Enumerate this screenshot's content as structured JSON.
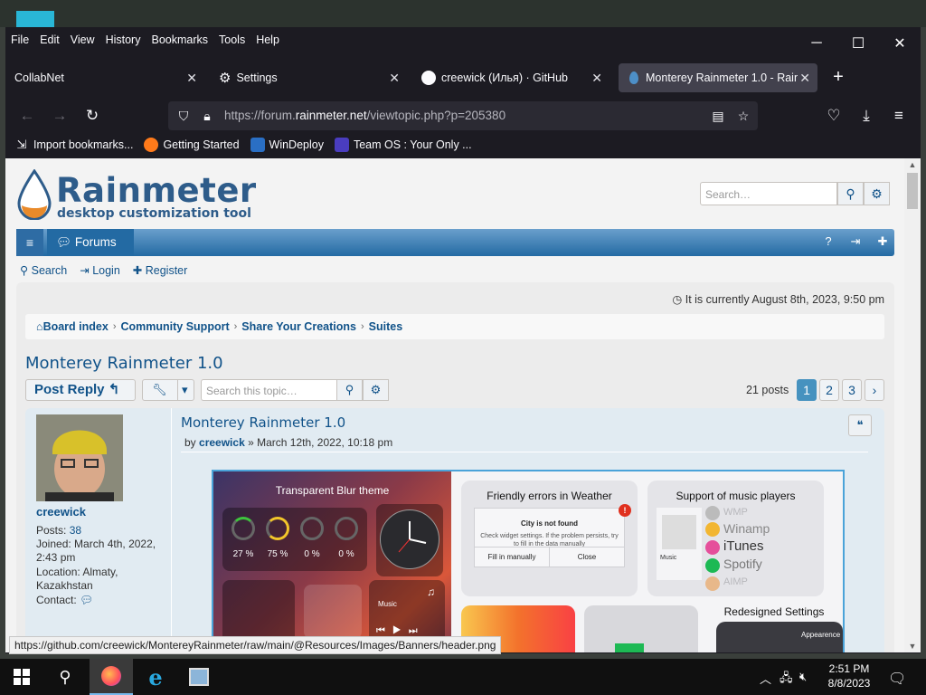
{
  "browser": {
    "menu": [
      "File",
      "Edit",
      "View",
      "History",
      "Bookmarks",
      "Tools",
      "Help"
    ],
    "window_controls": {
      "minimize": "─",
      "maximize": "☐",
      "close": "✕"
    },
    "tabs": [
      {
        "label": "CollabNet",
        "icon": "none"
      },
      {
        "label": "Settings",
        "icon": "gear-icon"
      },
      {
        "label": "creewick (Илья) · GitHub",
        "icon": "github-icon"
      },
      {
        "label": "Monterey Rainmeter 1.0 - Rainm",
        "icon": "rainmeter-drop-icon",
        "active": true
      }
    ],
    "url_prefix": "https://forum.",
    "url_domain": "rainmeter.net",
    "url_path": "/viewtopic.php?p=205380",
    "bookmarks": [
      {
        "label": "Import bookmarks...",
        "icon": "import-icon"
      },
      {
        "label": "Getting Started",
        "icon": "firefox-icon"
      },
      {
        "label": "WinDeploy",
        "icon": "windeploy-icon"
      },
      {
        "label": "Team OS : Your Only ...",
        "icon": "teamos-icon"
      }
    ],
    "status_url": "https://github.com/creewick/MontereyRainmeter/raw/main/@Resources/Images/Banners/header.png"
  },
  "site": {
    "logo_title": "Rainmeter",
    "logo_tagline": "desktop customization tool",
    "search_placeholder": "Search…",
    "nav_forums": "Forums",
    "subnav": {
      "search": "Search",
      "login": "Login",
      "register": "Register"
    },
    "current_time": "It is currently August 8th, 2023, 9:50 pm",
    "breadcrumbs": [
      "Board index",
      "Community Support",
      "Share Your Creations",
      "Suites"
    ],
    "brand_color": "#105289"
  },
  "topic": {
    "title": "Monterey Rainmeter 1.0",
    "post_reply": "Post Reply",
    "search_placeholder": "Search this topic…",
    "posts_count": "21 posts",
    "pages": [
      "1",
      "2",
      "3"
    ],
    "current_page": "1"
  },
  "post": {
    "author": "creewick",
    "posts_label": "Posts:",
    "posts_value": "38",
    "joined_label": "Joined:",
    "joined_value": "March 4th, 2022, 2:43 pm",
    "location_label": "Location:",
    "location_value": "Almaty, Kazakhstan",
    "contact_label": "Contact:",
    "title": "Monterey Rainmeter 1.0",
    "by": "by",
    "date": "» March 12th, 2022, 10:18 pm"
  },
  "banner": {
    "left_title": "Transparent Blur theme",
    "pcts": [
      "27 %",
      "75 %",
      "0 %",
      "0 %"
    ],
    "music_label": "Music",
    "errors_title": "Friendly errors in Weather",
    "err_heading": "City is not found",
    "err_text": "Check widget settings. If the problem persists, try to fill in the data manually",
    "err_btn1": "Fill in manually",
    "err_btn2": "Close",
    "err_mark": "!",
    "players_title": "Support of music players",
    "players": [
      "WMP",
      "Winamp",
      "iTunes",
      "Spotify",
      "AIMP"
    ],
    "player_music": "Music",
    "settings_title": "Redesigned Settings",
    "settings_label": "Appearence"
  },
  "taskbar": {
    "time": "2:51 PM",
    "date": "8/8/2023"
  }
}
